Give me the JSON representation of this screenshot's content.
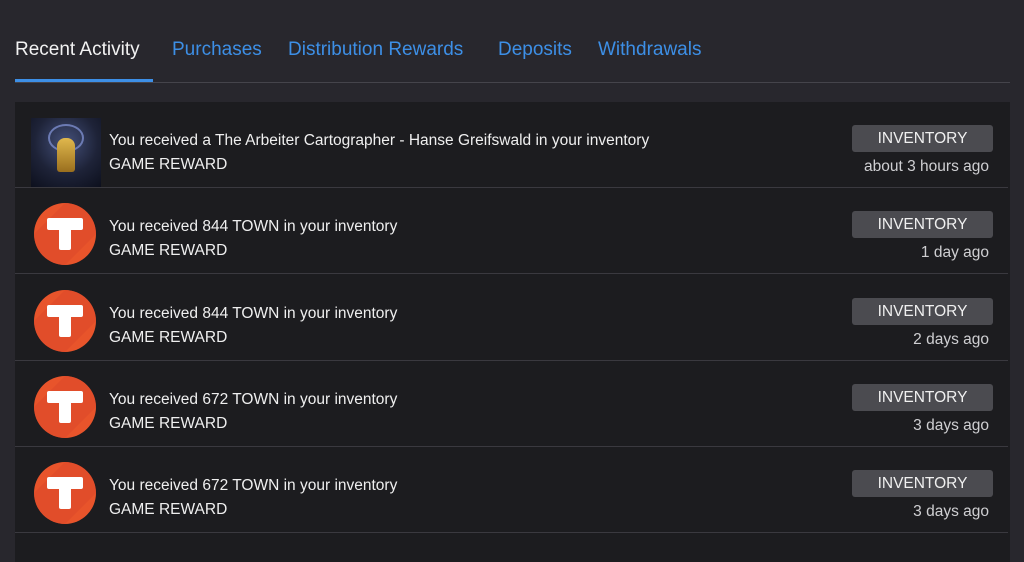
{
  "tabs": [
    {
      "label": "Recent Activity",
      "active": true
    },
    {
      "label": "Purchases"
    },
    {
      "label": "Distribution Rewards"
    },
    {
      "label": "Deposits"
    },
    {
      "label": "Withdrawals"
    }
  ],
  "activity": [
    {
      "icon": "nft-card-thumbnail",
      "message": "You received a The Arbeiter Cartographer - Hanse Greifswald in your inventory",
      "type": "GAME REWARD",
      "badge": "INVENTORY",
      "time": "about 3 hours ago"
    },
    {
      "icon": "town-token-icon",
      "message": "You received 844 TOWN in your inventory",
      "type": "GAME REWARD",
      "badge": "INVENTORY",
      "time": "1 day ago"
    },
    {
      "icon": "town-token-icon",
      "message": "You received 844 TOWN in your inventory",
      "type": "GAME REWARD",
      "badge": "INVENTORY",
      "time": "2 days ago"
    },
    {
      "icon": "town-token-icon",
      "message": "You received 672 TOWN in your inventory",
      "type": "GAME REWARD",
      "badge": "INVENTORY",
      "time": "3 days ago"
    },
    {
      "icon": "town-token-icon",
      "message": "You received 672 TOWN in your inventory",
      "type": "GAME REWARD",
      "badge": "INVENTORY",
      "time": "3 days ago"
    }
  ],
  "colors": {
    "accent": "#3d8fe6",
    "background": "#28272d",
    "panel": "#1c1c1f",
    "badge": "#4b4b50",
    "token_orange": "#e8542b"
  }
}
